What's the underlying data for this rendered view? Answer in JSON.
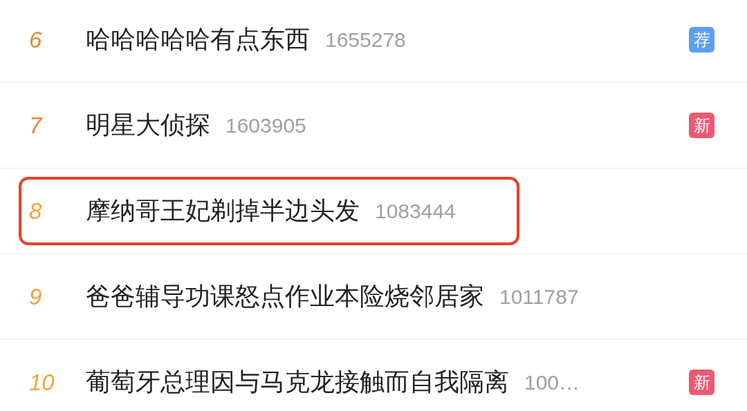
{
  "hot_list": [
    {
      "rank": "6",
      "title": "哈哈哈哈哈有点东西",
      "count": "1655278",
      "color": "#e8862c",
      "highlighted": false,
      "badge": {
        "kind": "recommend",
        "text": "荐"
      }
    },
    {
      "rank": "7",
      "title": "明星大侦探",
      "count": "1603905",
      "color": "#e8862c",
      "highlighted": false,
      "badge": {
        "kind": "new",
        "text": "新"
      }
    },
    {
      "rank": "8",
      "title": "摩纳哥王妃剃掉半边头发",
      "count": "1083444",
      "color": "#f0a43c",
      "highlighted": true
    },
    {
      "rank": "9",
      "title": "爸爸辅导功课怒点作业本险烧邻居家",
      "count": "1011787",
      "color": "#f0a43c",
      "highlighted": false
    },
    {
      "rank": "10",
      "title": "葡萄牙总理因与马克龙接触而自我隔离",
      "count": "100…",
      "color": "#f0a43c",
      "highlighted": false,
      "badge": {
        "kind": "new",
        "text": "新"
      }
    }
  ]
}
